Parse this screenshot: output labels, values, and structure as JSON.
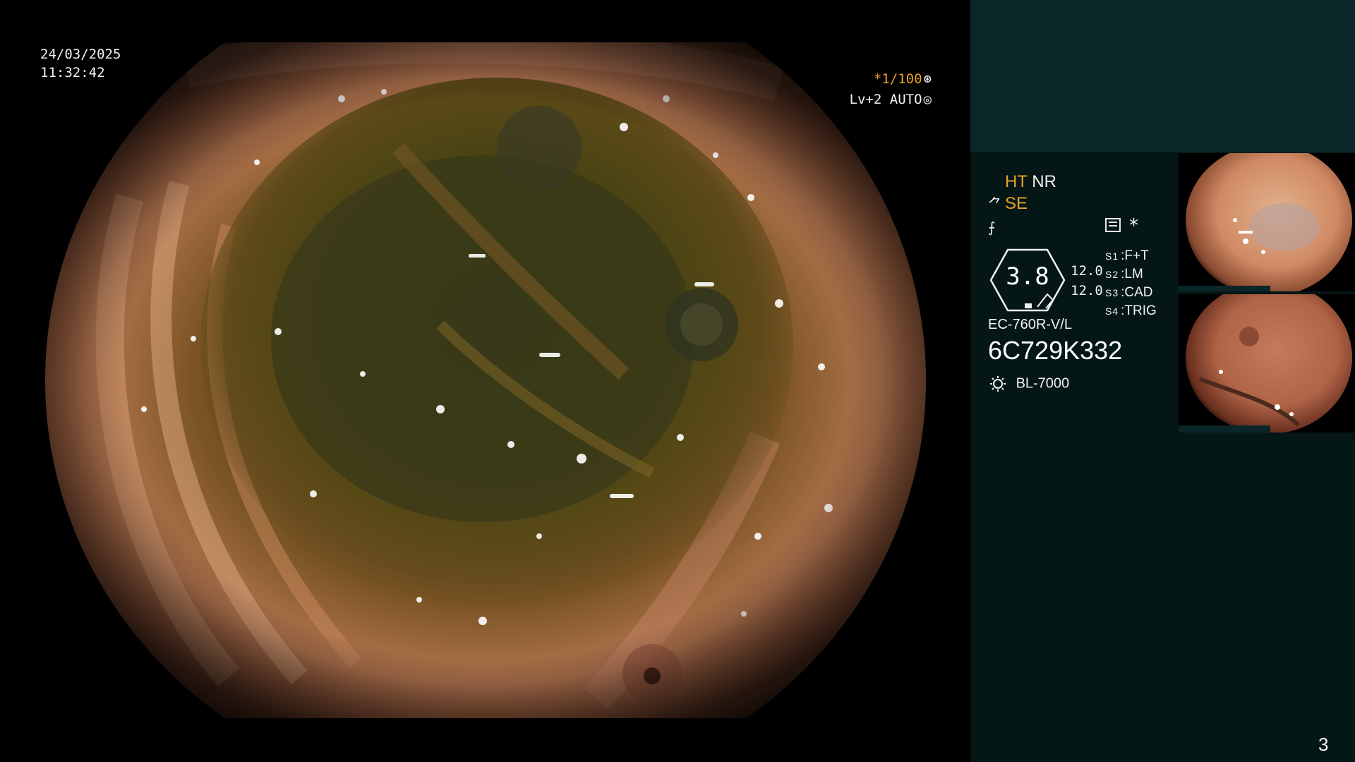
{
  "overlay": {
    "date": "24/03/2025",
    "time": "11:32:42",
    "shutter": "*1/100",
    "level": "Lv+2 AUTO"
  },
  "panel": {
    "mode_line1_a": "HT",
    "mode_line1_b": "NR",
    "mode_line2": "SE",
    "gauge_value": "3.8",
    "numbers": [
      "12.0",
      "12.0"
    ],
    "switches": [
      {
        "key": "S1",
        "value": "F+T"
      },
      {
        "key": "S2",
        "value": "LM"
      },
      {
        "key": "S3",
        "value": "CAD"
      },
      {
        "key": "S4",
        "value": "TRIG"
      }
    ],
    "scope_model": "EC-760R-V/L",
    "scope_serial": "6C729K332",
    "light_source": "BL-7000",
    "page_number": "3"
  },
  "colors": {
    "accent_orange": "#e6a227",
    "panel_top": "#0b2628",
    "panel_main": "#041616"
  },
  "icons": {
    "shutter": "aperture-icon",
    "level": "target-icon",
    "structure_enhancement": "structure-enhance-icon",
    "color_enhancement": "color-enhance-icon",
    "menu": "menu-list-icon",
    "light": "sun-icon"
  }
}
